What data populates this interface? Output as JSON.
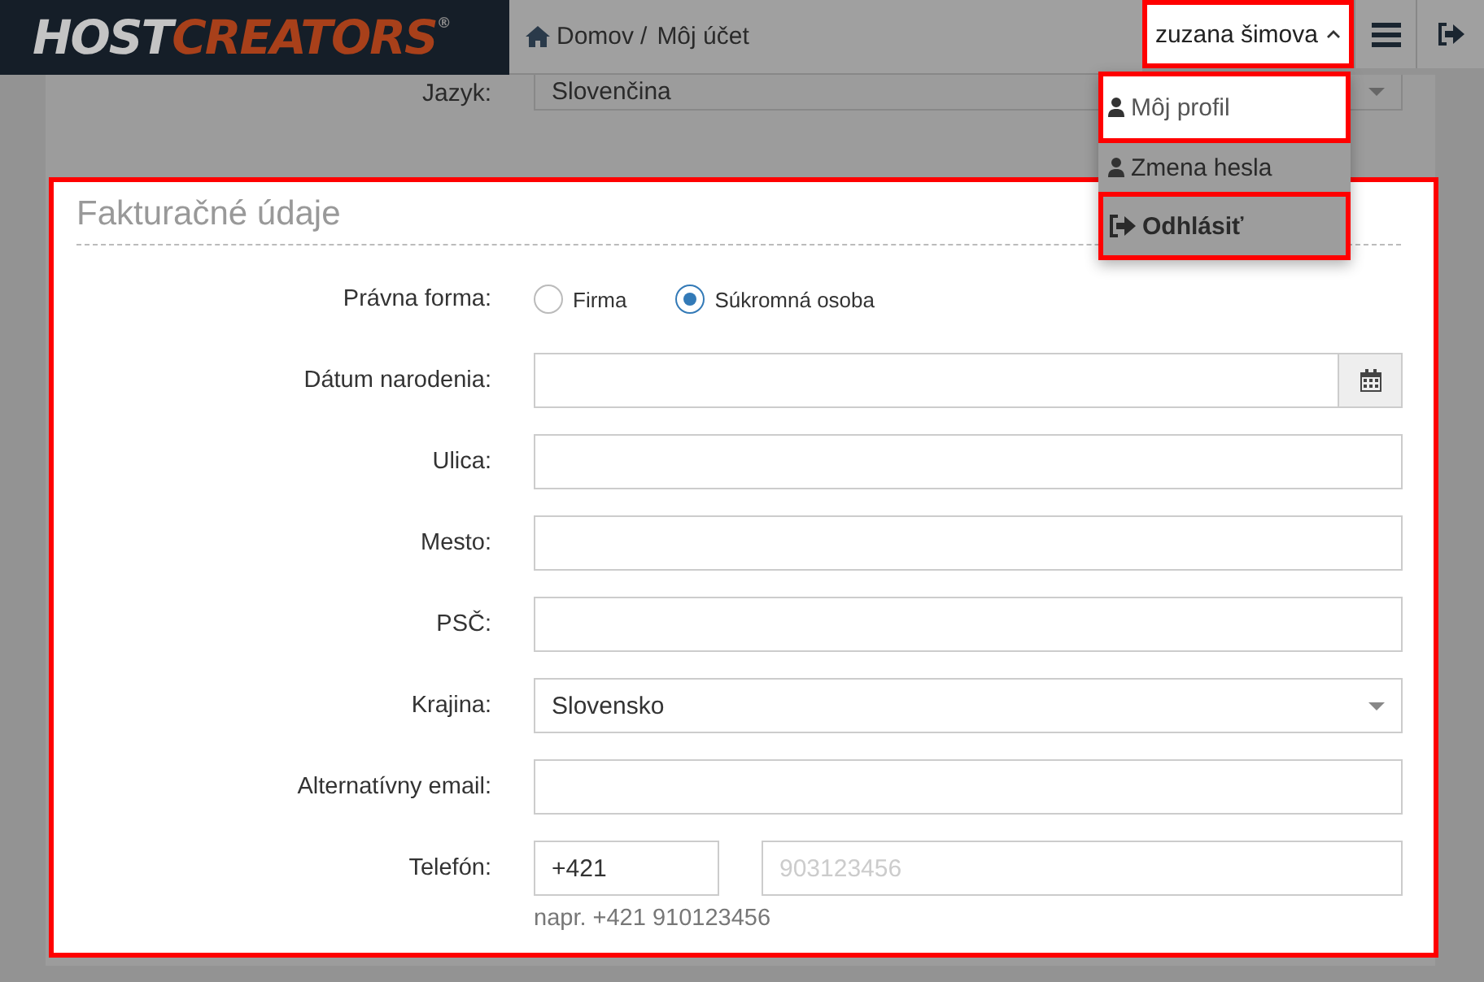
{
  "header": {
    "logo": {
      "part1": "HOST",
      "part2": "CREATORS",
      "mark": "®"
    },
    "breadcrumb": [
      {
        "label": "Domov",
        "separator": "/"
      },
      {
        "label": "Môj účet"
      }
    ],
    "user_menu": {
      "label": "zuzana šimova",
      "expanded": true,
      "highlighted": true,
      "framed": true
    }
  },
  "user_dropdown": [
    {
      "label": "Môj profil",
      "kind": "user",
      "bold": false,
      "highlighted": true,
      "framed": true
    },
    {
      "label": "Zmena hesla",
      "kind": "user",
      "bold": false,
      "highlighted": false,
      "framed": false
    },
    {
      "label": "Odhlásiť",
      "kind": "logout",
      "bold": true,
      "highlighted": false,
      "framed": true
    }
  ],
  "language_row": {
    "label": "Jazyk:",
    "value": "Slovenčina"
  },
  "billing": {
    "title": "Fakturačné údaje",
    "highlighted": true,
    "framed": true,
    "fields": [
      {
        "kind": "radio",
        "label": "Právna forma:",
        "options": [
          {
            "label": "Firma",
            "selected": false
          },
          {
            "label": "Súkromná osoba",
            "selected": true
          }
        ]
      },
      {
        "kind": "date",
        "label": "Dátum narodenia:"
      },
      {
        "kind": "text",
        "label": "Ulica:"
      },
      {
        "kind": "text",
        "label": "Mesto:"
      },
      {
        "kind": "text",
        "label": "PSČ:"
      },
      {
        "kind": "select",
        "label": "Krajina:",
        "value": "Slovensko"
      },
      {
        "kind": "text",
        "label": "Alternatívny email:"
      },
      {
        "kind": "phone",
        "label": "Telefón:",
        "value": "+421",
        "placeholder": "903123456",
        "hint": "napr. +421 910123456"
      }
    ]
  }
}
